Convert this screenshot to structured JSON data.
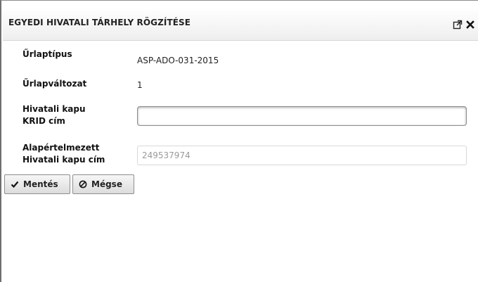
{
  "dialog": {
    "title": "EGYEDI HIVATALI TÁRHELY RÖGZÍTÉSE",
    "icons": [
      "external-link-icon",
      "close-icon"
    ]
  },
  "form": {
    "form_type_label": "Űrlaptípus",
    "form_type_value": "ASP-ADO-031-2015",
    "form_variant_label": "Űrlapváltozat",
    "form_variant_value": "1",
    "krid_label_line1": "Hivatali kapu",
    "krid_label_line2": "KRID cím",
    "krid_value": "",
    "default_label_line1": "Alapértelmezett",
    "default_label_line2": "Hivatali kapu cím",
    "default_placeholder": "249537974"
  },
  "buttons": {
    "save_label": "Mentés",
    "cancel_label": "Mégse"
  }
}
